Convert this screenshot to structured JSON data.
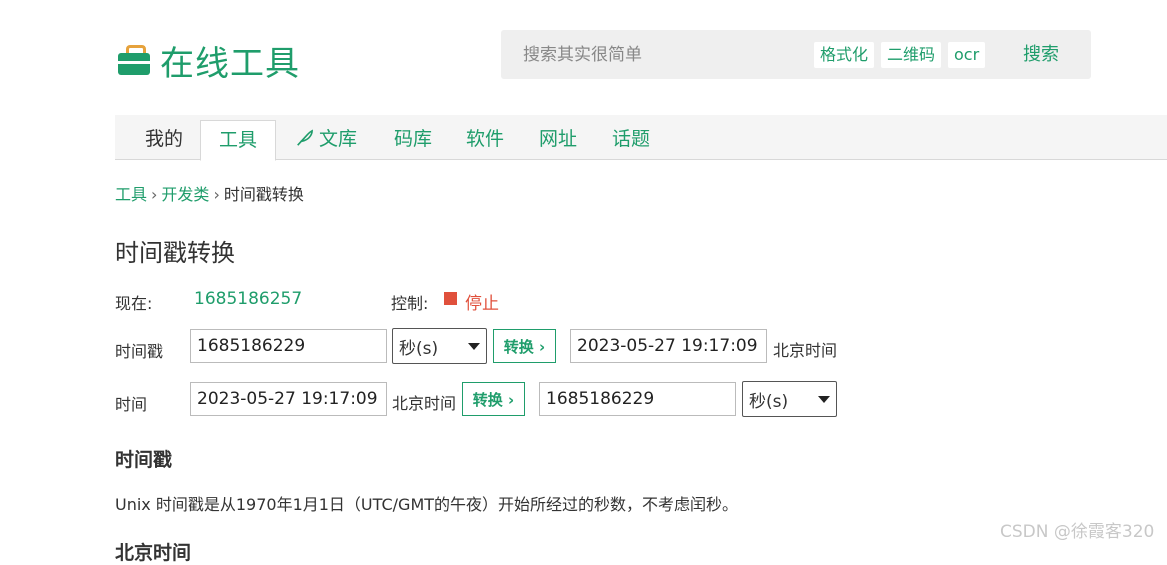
{
  "header": {
    "logo_text": "在线工具",
    "search": {
      "placeholder": "搜索其实很简单",
      "chips": [
        "格式化",
        "二维码",
        "ocr"
      ],
      "button": "搜索"
    }
  },
  "nav": {
    "items": [
      "我的",
      "工具",
      "文库",
      "码库",
      "软件",
      "网址",
      "话题"
    ],
    "active": "工具"
  },
  "breadcrumb": {
    "items": [
      "工具",
      "开发类",
      "时间戳转换"
    ],
    "separator": "›"
  },
  "page": {
    "title": "时间戳转换",
    "now_label": "现在:",
    "now_value": "1685186257",
    "control_label": "控制:",
    "control_action": "停止",
    "row1": {
      "label": "时间戳",
      "input": "1685186229",
      "unit": "秒(s)",
      "button": "转换 ›",
      "output": "2023-05-27 19:17:09",
      "suffix": "北京时间"
    },
    "row2": {
      "label": "时间",
      "input": "2023-05-27 19:17:09",
      "tz": "北京时间",
      "button": "转换 ›",
      "output": "1685186229",
      "unit": "秒(s)"
    },
    "section_title": "时间戳",
    "description": "Unix 时间戳是从1970年1月1日（UTC/GMT的午夜）开始所经过的秒数，不考虑闰秒。",
    "next_section_partial": "北京时间"
  },
  "watermark": "CSDN @徐霞客320",
  "colors": {
    "brand": "#1f9d6b",
    "stop": "#e0503c",
    "logo_handle": "#e6a23c"
  }
}
